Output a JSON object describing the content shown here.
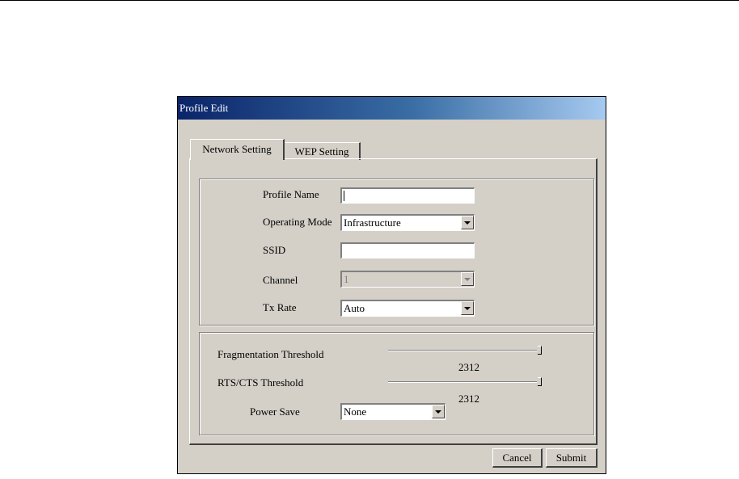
{
  "window": {
    "title": "Profile Edit"
  },
  "tabs": [
    {
      "label": "Network Setting",
      "active": true
    },
    {
      "label": "WEP Setting",
      "active": false
    }
  ],
  "network": {
    "profile_name": {
      "label": "Profile Name",
      "value": ""
    },
    "operating_mode": {
      "label": "Operating Mode",
      "value": "Infrastructure"
    },
    "ssid": {
      "label": "SSID",
      "value": ""
    },
    "channel": {
      "label": "Channel",
      "value": "1",
      "disabled": true
    },
    "tx_rate": {
      "label": "Tx Rate",
      "value": "Auto"
    }
  },
  "advanced": {
    "fragmentation": {
      "label": "Fragmentation Threshold",
      "value": "2312"
    },
    "rts_cts": {
      "label": "RTS/CTS Threshold",
      "value": "2312"
    },
    "power_save": {
      "label": "Power Save",
      "value": "None"
    }
  },
  "buttons": {
    "cancel": "Cancel",
    "submit": "Submit"
  },
  "colors": {
    "dialog_bg": "#d4d0c8",
    "title_start": "#0a246a",
    "title_end": "#a6caf0"
  }
}
